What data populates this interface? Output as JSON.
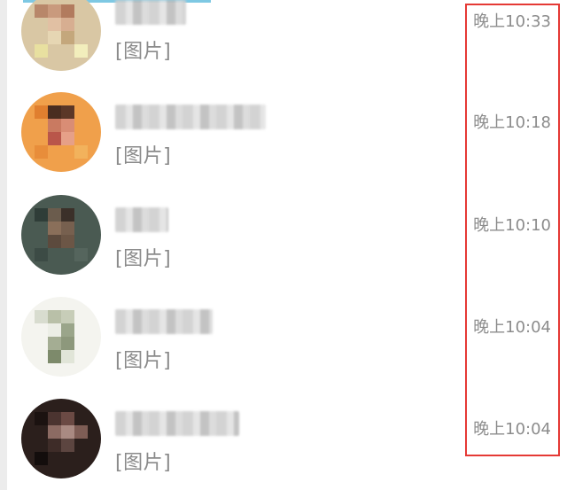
{
  "chats": [
    {
      "preview": "[图片]",
      "time": "晚上10:33",
      "avatar_icon": "contact-avatar-icon"
    },
    {
      "preview": "[图片]",
      "time": "晚上10:18",
      "avatar_icon": "contact-avatar-icon"
    },
    {
      "preview": "[图片]",
      "time": "晚上10:10",
      "avatar_icon": "contact-avatar-icon"
    },
    {
      "preview": "[图片]",
      "time": "晚上10:04",
      "avatar_icon": "contact-avatar-icon"
    },
    {
      "preview": "[图片]",
      "time": "晚上10:04",
      "avatar_icon": "contact-avatar-icon"
    }
  ],
  "colors": {
    "highlight": "#e53935",
    "time_text": "#8c8c8c",
    "preview_text": "#8a8a8a"
  }
}
